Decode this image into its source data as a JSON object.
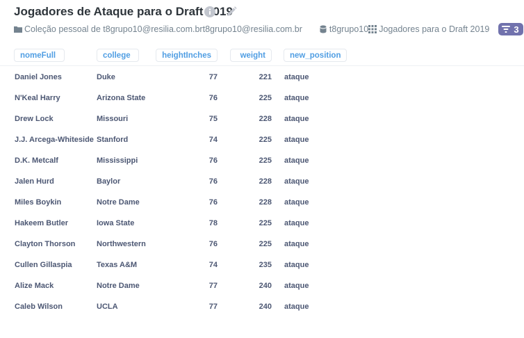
{
  "header": {
    "title": "Jogadores de Ataque para o Draft 2019"
  },
  "meta": {
    "collection": "Coleção pessoal de t8grupo10@resilia.com.br",
    "owner": "t8grupo10@resilia.com.br",
    "database": "t8grupo10",
    "table": "Jogadores para o Draft 2019",
    "filter_count": "3"
  },
  "columns": [
    "nomeFull",
    "college",
    "heightInches",
    "weight",
    "new_position"
  ],
  "rows": [
    [
      "Daniel Jones",
      "Duke",
      "77",
      "221",
      "ataque"
    ],
    [
      "N'Keal Harry",
      "Arizona State",
      "76",
      "225",
      "ataque"
    ],
    [
      "Drew Lock",
      "Missouri",
      "75",
      "228",
      "ataque"
    ],
    [
      "J.J. Arcega-Whiteside",
      "Stanford",
      "74",
      "225",
      "ataque"
    ],
    [
      "D.K. Metcalf",
      "Mississippi",
      "76",
      "225",
      "ataque"
    ],
    [
      "Jalen Hurd",
      "Baylor",
      "76",
      "228",
      "ataque"
    ],
    [
      "Miles Boykin",
      "Notre Dame",
      "76",
      "228",
      "ataque"
    ],
    [
      "Hakeem Butler",
      "Iowa State",
      "78",
      "225",
      "ataque"
    ],
    [
      "Clayton Thorson",
      "Northwestern",
      "76",
      "225",
      "ataque"
    ],
    [
      "Cullen Gillaspia",
      "Texas A&M",
      "74",
      "235",
      "ataque"
    ],
    [
      "Alize Mack",
      "Notre Dame",
      "77",
      "240",
      "ataque"
    ],
    [
      "Caleb Wilson",
      "UCLA",
      "77",
      "240",
      "ataque"
    ]
  ],
  "colors": {
    "accent": "#509ee3",
    "badge": "#7172ad",
    "text": "#4c5773",
    "title": "#2e353b"
  }
}
